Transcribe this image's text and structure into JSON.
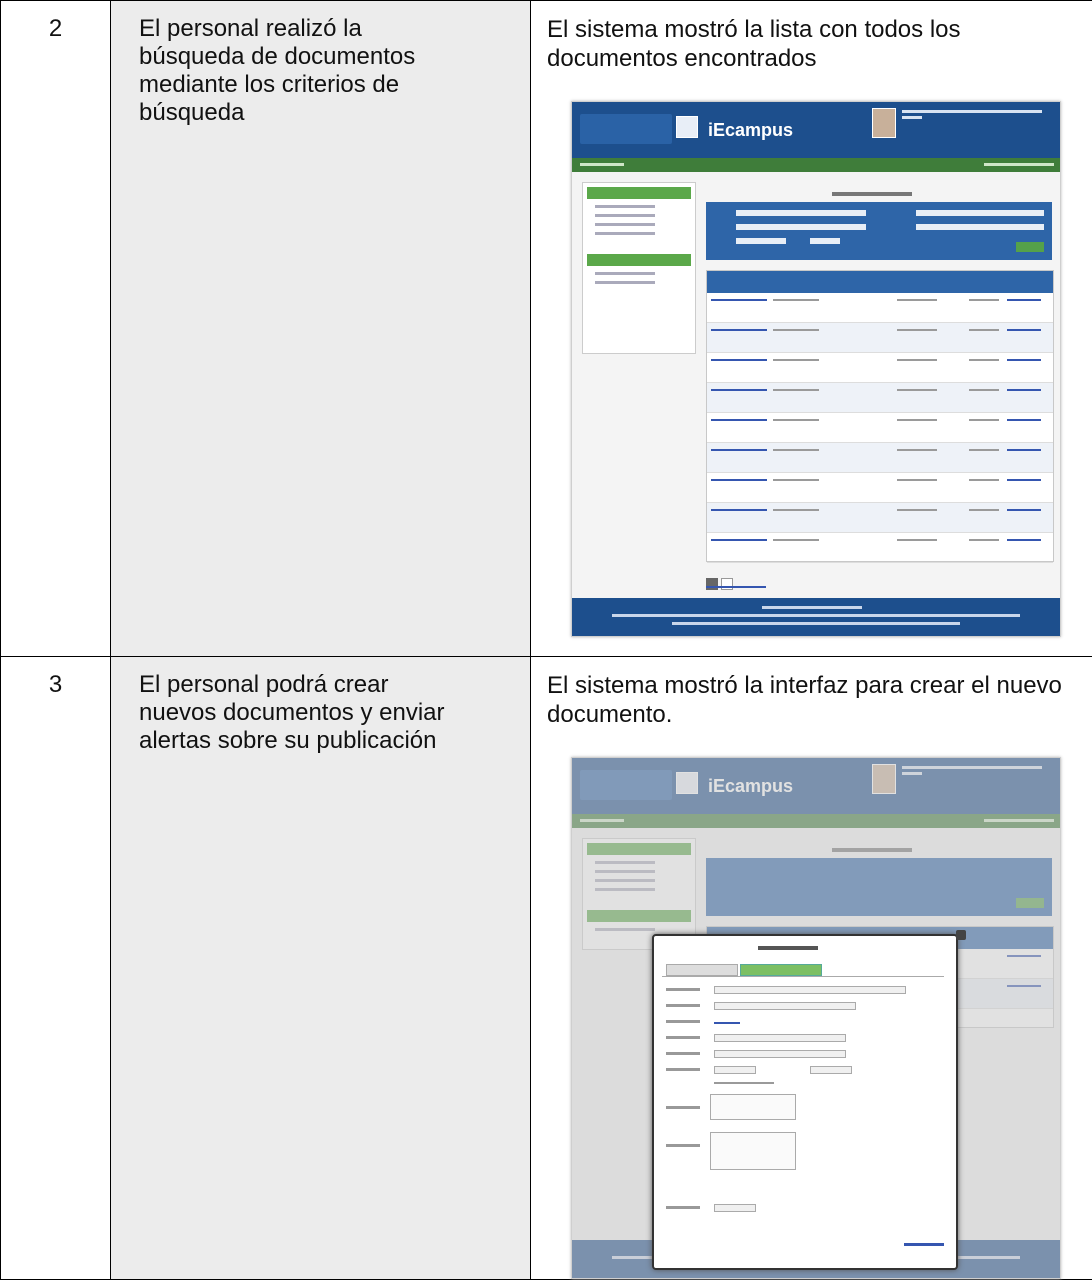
{
  "rows": [
    {
      "number": "2",
      "action_lines": [
        "El personal realizó la",
        "búsqueda de documentos",
        "mediante los criterios de",
        "búsqueda"
      ],
      "result": "El sistema mostró la lista con todos los documentos encontrados",
      "screenshot": {
        "brand": "iEcampus"
      }
    },
    {
      "number": "3",
      "action_lines": [
        "El personal podrá crear",
        "nuevos documentos y enviar",
        "alertas sobre su publicación"
      ],
      "result": "El sistema mostró la interfaz para crear el nuevo documento.",
      "screenshot": {
        "brand": "iEcampus"
      }
    }
  ]
}
